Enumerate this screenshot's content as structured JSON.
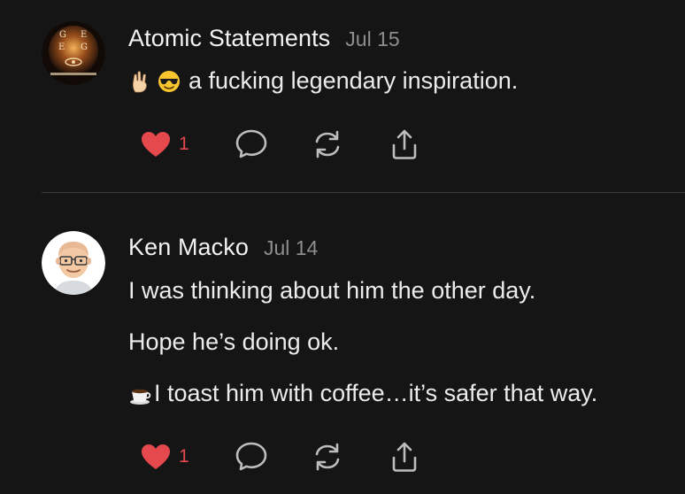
{
  "colors": {
    "background": "#151515",
    "text": "#ececec",
    "muted": "#8d8d8d",
    "like": "#e5484d",
    "icon": "#bdbdbd",
    "divider": "#3a3a3a"
  },
  "comments": [
    {
      "author": "Atomic Statements",
      "date": "Jul 15",
      "avatar_icon": "book-cover-avatar",
      "lines": [
        {
          "emojis": [
            "rock-on-hand-icon",
            "sunglasses-face-icon"
          ],
          "text": "a fucking legendary inspiration."
        }
      ],
      "actions": {
        "like_count": "1",
        "like_icon": "heart-icon",
        "reply_icon": "chat-bubble-icon",
        "restack_icon": "restack-icon",
        "share_icon": "share-icon"
      }
    },
    {
      "author": "Ken Macko",
      "date": "Jul 14",
      "avatar_icon": "bald-man-glasses-avatar",
      "lines": [
        {
          "text": "I was thinking about him the other day."
        },
        {
          "text": "Hope he’s doing ok."
        },
        {
          "emojis": [
            "coffee-cup-icon"
          ],
          "text": "I toast him with coffee…it’s safer that way."
        }
      ],
      "actions": {
        "like_count": "1",
        "like_icon": "heart-icon",
        "reply_icon": "chat-bubble-icon",
        "restack_icon": "restack-icon",
        "share_icon": "share-icon"
      }
    }
  ]
}
